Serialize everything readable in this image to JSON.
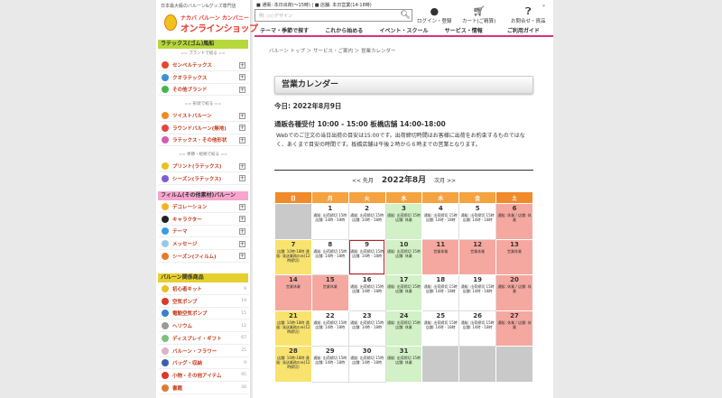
{
  "header": {
    "tagline": "日本最大級のバルーン&グッズ専門店",
    "logo_line1": "ナカバ バルーン カンパニー",
    "logo_line2": "オンラインショップ",
    "notice1": "■ 通販: 本日出荷(〜15時) | ■ 店舗: 本日営業(14-18時)",
    "search_placeholder": "例: ○○デザイン",
    "login_label": "ログイン・登録",
    "cart_label": "カート(ご精算)",
    "help_label": "お問合せ・資品"
  },
  "nav": [
    "テーマ・季節で探す",
    "これから始める",
    "イベント・スクール",
    "サービス・情報",
    "ご利用ガイド"
  ],
  "sidebar": {
    "latex_header": "ラテックス(ゴム)風船",
    "latex_sub1": "== ブランドで絞る ==",
    "latex_items": [
      {
        "label": "センペルテックス",
        "color": "#e8442e"
      },
      {
        "label": "クオラテックス",
        "color": "#3a8fd8"
      },
      {
        "label": "その他ブランド",
        "color": "#47b54a"
      }
    ],
    "latex_sub2": "== 形状で絞る ==",
    "latex_items2": [
      {
        "label": "ツイストバルーン",
        "color": "#f08a24"
      },
      {
        "label": "ラウンドバルーン(無地)",
        "color": "#e64444"
      },
      {
        "label": "ラテックス・その他形状",
        "color": "#d65bb0"
      }
    ],
    "latex_sub3": "== 季節・絵柄で絞る ==",
    "latex_items3": [
      {
        "label": "プリント(ラテックス)",
        "color": "#e8c21a"
      },
      {
        "label": "シーズン(ラテックス)",
        "color": "#7b5bd6"
      }
    ],
    "film_header": "フィルム(その他素材)バルーン",
    "film_items": [
      {
        "label": "デコレーション",
        "color": "#f2b424"
      },
      {
        "label": "キャラクター",
        "color": "#222222"
      },
      {
        "label": "テーマ",
        "color": "#3b9be0"
      },
      {
        "label": "メッセージ",
        "color": "#9ac9e6"
      },
      {
        "label": "シーズン(フィルム)",
        "color": "#e87a2a"
      }
    ],
    "goods_header": "バルーン関係商品",
    "goods_items": [
      {
        "label": "初心者キット",
        "color": "#e8c21a",
        "count": "9"
      },
      {
        "label": "空気ポンプ",
        "color": "#d83a2a",
        "count": "19"
      },
      {
        "label": "電動空気ポンプ",
        "color": "#3a7fd0",
        "count": "15"
      },
      {
        "label": "ヘリウム",
        "color": "#9a9a9a",
        "count": "12"
      },
      {
        "label": "ディスプレイ・ギフト",
        "color": "#7ec07e",
        "count": "67"
      },
      {
        "label": "バルーン・フラワー",
        "color": "#e0b0c8",
        "count": "25"
      },
      {
        "label": "バッグ・収納",
        "color": "#3a5fb0",
        "count": "9"
      },
      {
        "label": "小物・その他アイテム",
        "color": "#d83a2a",
        "count": "95"
      },
      {
        "label": "書籍",
        "color": "#e07a30",
        "count": "30"
      }
    ]
  },
  "breadcrumb": "バルーン トップ ＞ サービス・ご案内 ＞ 営業カレンダー",
  "page_title": "営業カレンダー",
  "today_label": "今日: 2022年8月9日",
  "hours_label": "通販各種受付 10:00 - 15:00 板橋店舗 14:00-18:00",
  "note": "Webでのご注文の当日出荷の目安は15:00です。出荷締切時間はお客様に出荷をお約束するものではなく、あくまで目安の時間です。板橋店舗は午後２時から６時までの営業となります。",
  "calendar": {
    "prev": "<< 先月",
    "month": "2022年8月",
    "next": "次月 >>",
    "weekdays": [
      "日",
      "月",
      "火",
      "水",
      "木",
      "金",
      "土"
    ],
    "weekday_colors": [
      "#f08a2a",
      "#f5a340",
      "#f5a340",
      "#f5a340",
      "#f5a340",
      "#f5a340",
      "#f08a2a"
    ],
    "weeks": [
      [
        {
          "d": "",
          "t": "",
          "c": "gray"
        },
        {
          "d": "1",
          "t": "通販: 出荷締切 15時 店舗: 14時 - 18時",
          "c": "normal"
        },
        {
          "d": "2",
          "t": "通販: 出荷締切 15時 店舗: 14時 - 18時",
          "c": "normal"
        },
        {
          "d": "3",
          "t": "通販: 出荷締切 15時 店舗: 休業",
          "c": "green"
        },
        {
          "d": "4",
          "t": "通販: 出荷締切 15時 店舗: 14時 - 18時",
          "c": "normal"
        },
        {
          "d": "5",
          "t": "通販: 出荷締切 15時 店舗: 14時 - 18時",
          "c": "normal"
        },
        {
          "d": "6",
          "t": "通販: 休業 / 店舗: 休業",
          "c": "pink"
        }
      ],
      [
        {
          "d": "7",
          "t": "店舗: 10時-18時 通販: 発送業務のみ(12時締切)",
          "c": "yellow"
        },
        {
          "d": "8",
          "t": "通販: 出荷締切 15時 店舗: 14時 - 18時",
          "c": "normal"
        },
        {
          "d": "9",
          "t": "通販: 出荷締切 15時 店舗: 14時 - 18時",
          "c": "normal",
          "today": true
        },
        {
          "d": "10",
          "t": "通販: 出荷締切 15時 店舗: 休業",
          "c": "green"
        },
        {
          "d": "11",
          "t": "営業休業",
          "c": "pink"
        },
        {
          "d": "12",
          "t": "営業休業",
          "c": "pink"
        },
        {
          "d": "13",
          "t": "営業休業",
          "c": "pink"
        }
      ],
      [
        {
          "d": "14",
          "t": "営業休業",
          "c": "pink"
        },
        {
          "d": "15",
          "t": "営業休業",
          "c": "pink"
        },
        {
          "d": "16",
          "t": "通販: 出荷締切 15時 店舗: 14時 - 18時",
          "c": "normal"
        },
        {
          "d": "17",
          "t": "通販: 出荷締切 15時 店舗: 休業",
          "c": "green"
        },
        {
          "d": "18",
          "t": "通販: 出荷締切 15時 店舗: 14時 - 18時",
          "c": "normal"
        },
        {
          "d": "19",
          "t": "通販: 出荷締切 15時 店舗: 14時 - 18時",
          "c": "normal"
        },
        {
          "d": "20",
          "t": "通販: 休業 / 店舗: 休業",
          "c": "pink"
        }
      ],
      [
        {
          "d": "21",
          "t": "店舗: 10時-18時 通販: 発送業務のみ(12時締切)",
          "c": "yellow"
        },
        {
          "d": "22",
          "t": "通販: 出荷締切 15時 店舗: 14時 - 18時",
          "c": "normal"
        },
        {
          "d": "23",
          "t": "通販: 出荷締切 15時 店舗: 14時 - 18時",
          "c": "normal"
        },
        {
          "d": "24",
          "t": "通販: 出荷締切 15時 店舗: 休業",
          "c": "green"
        },
        {
          "d": "25",
          "t": "通販: 出荷締切 15時 店舗: 14時 - 18時",
          "c": "normal"
        },
        {
          "d": "26",
          "t": "通販: 出荷締切 15時 店舗: 14時 - 18時",
          "c": "normal"
        },
        {
          "d": "27",
          "t": "通販: 休業 / 店舗: 休業",
          "c": "pink"
        }
      ],
      [
        {
          "d": "28",
          "t": "店舗: 10時-18時 通販: 発送業務のみ(12時締切)",
          "c": "yellow"
        },
        {
          "d": "29",
          "t": "通販: 出荷締切 15時 店舗: 14時 - 18時",
          "c": "normal"
        },
        {
          "d": "30",
          "t": "通販: 出荷締切 15時 店舗: 14時 - 18時",
          "c": "normal"
        },
        {
          "d": "31",
          "t": "通販: 出荷締切 15時 店舗: 休業",
          "c": "green"
        },
        {
          "d": "",
          "t": "",
          "c": "gray"
        },
        {
          "d": "",
          "t": "",
          "c": "gray"
        },
        {
          "d": "",
          "t": "",
          "c": "gray"
        }
      ]
    ]
  }
}
